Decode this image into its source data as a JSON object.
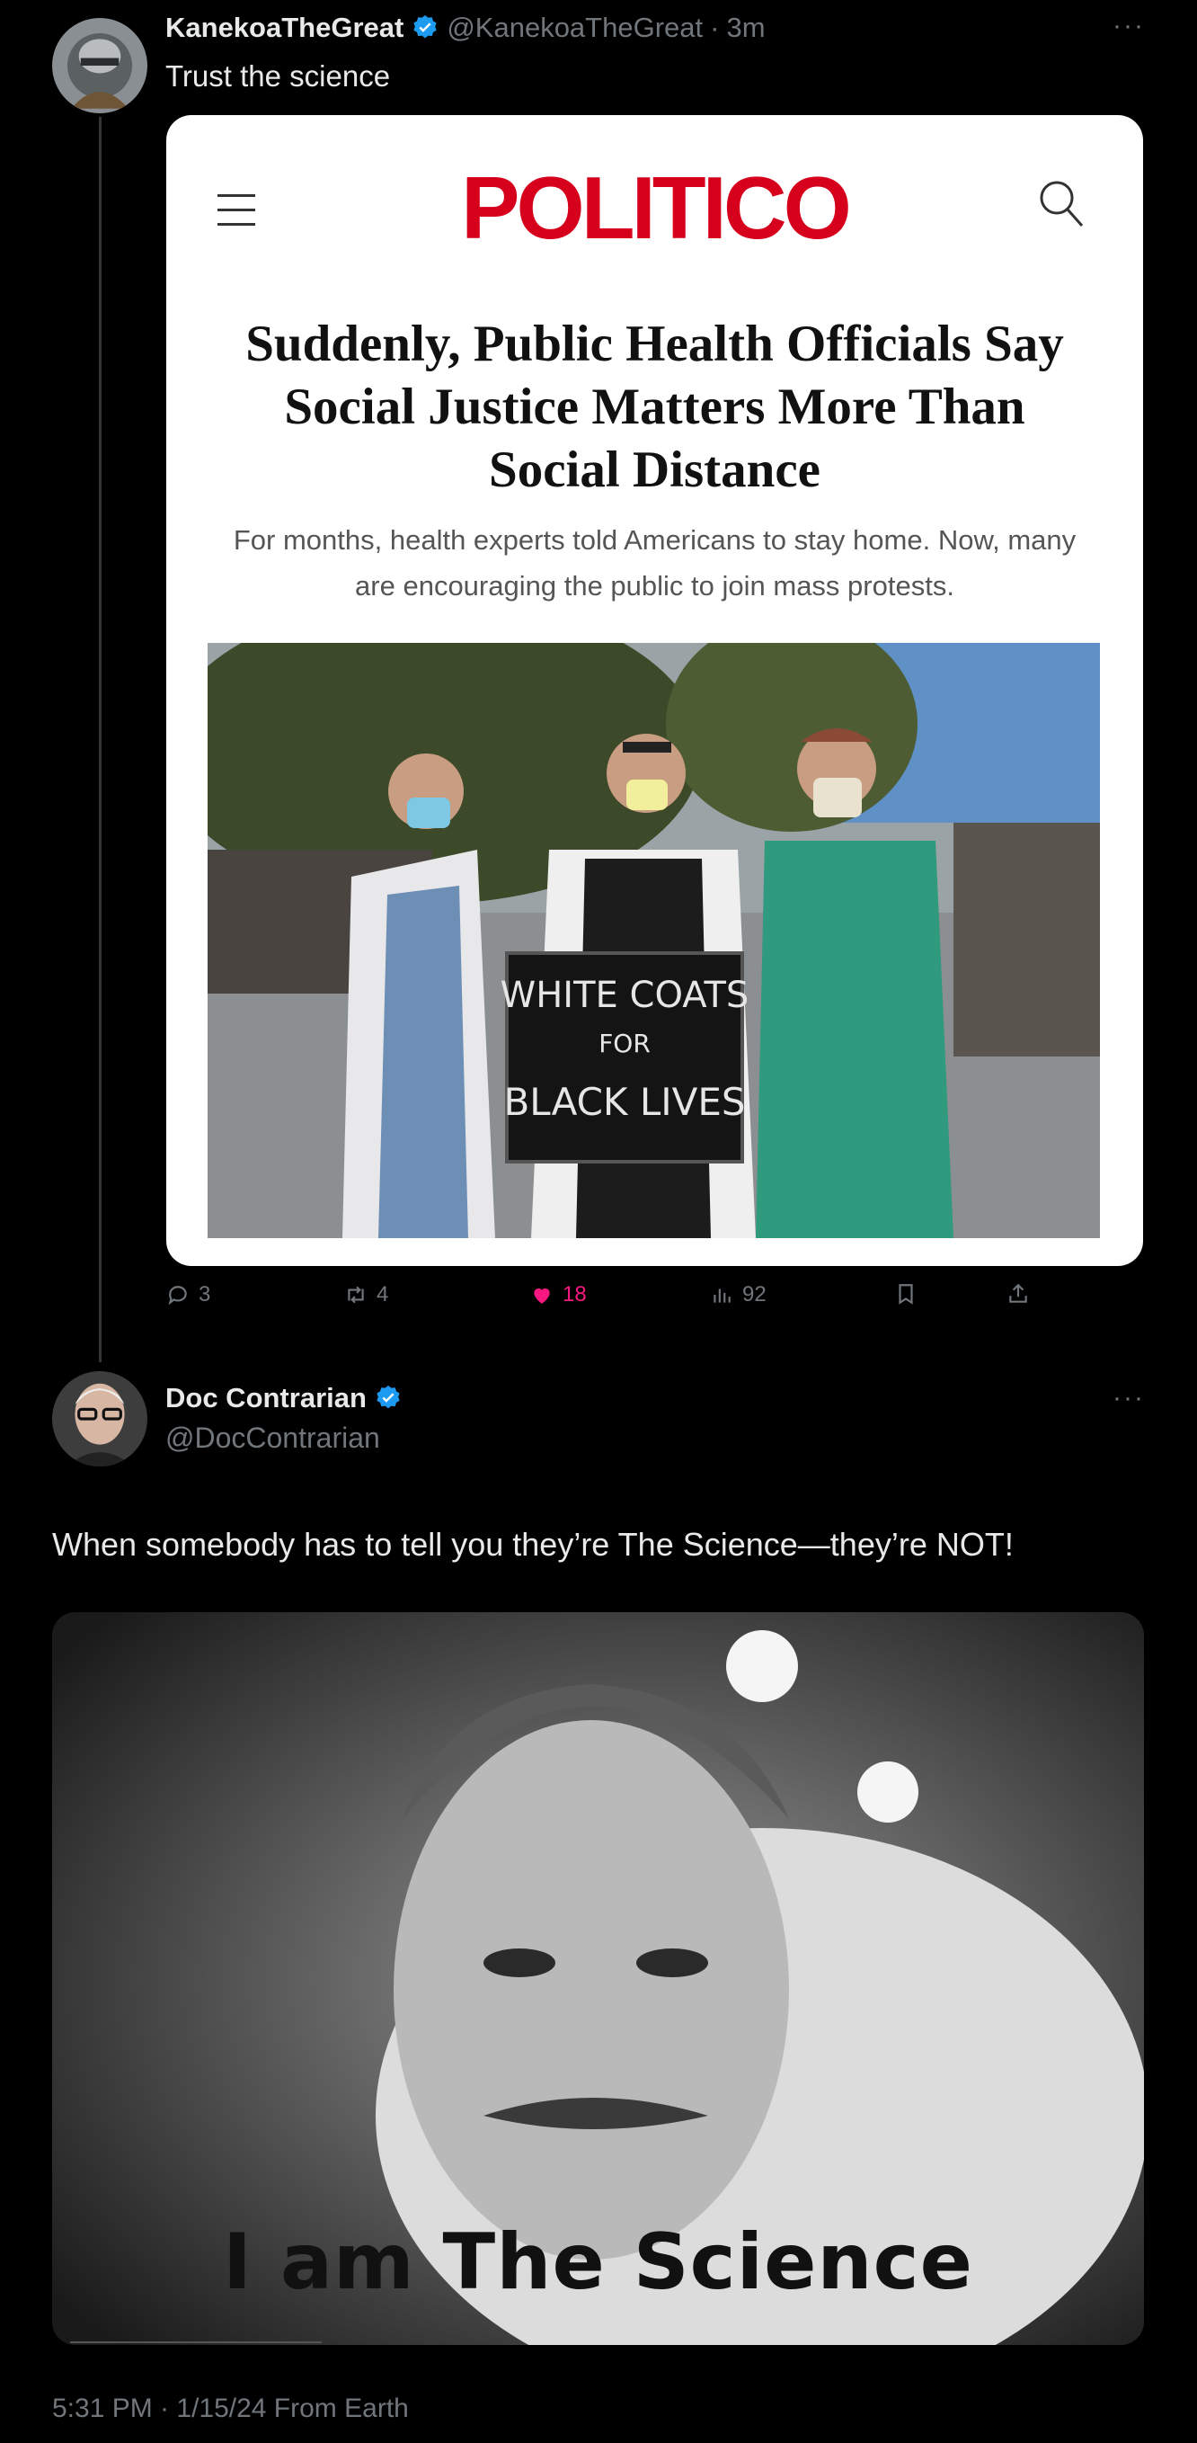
{
  "tweet1": {
    "display_name": "KanekoaTheGreat",
    "handle": "@KanekoaTheGreat",
    "separator": "·",
    "time": "3m",
    "more": "···",
    "text": "Trust the science",
    "card": {
      "brand": "POLITICO",
      "headline": "Suddenly, Public Health Officials Say Social Justice Matters More Than Social Distance",
      "dek": "For months, health experts told Americans to stay home. Now, many are encouraging the public to join mass protests.",
      "sign_text": [
        "WHITE COATS",
        "FOR",
        "BLACK LIVES"
      ]
    },
    "actions": {
      "replies": "3",
      "retweets": "4",
      "likes": "18",
      "views": "92"
    }
  },
  "tweet2": {
    "display_name": "Doc Contrarian",
    "handle": "@DocContrarian",
    "more": "···",
    "text": "When somebody has to tell you they’re The Science—they’re NOT!",
    "meme_caption": "I am The Science",
    "timestamp": "5:31 PM · 1/15/24 From Earth"
  },
  "colors": {
    "background": "#000000",
    "text": "#e7e9ea",
    "muted": "#71767b",
    "verified": "#1d9bf0",
    "like": "#f91880",
    "politico_red": "#d6001c"
  }
}
